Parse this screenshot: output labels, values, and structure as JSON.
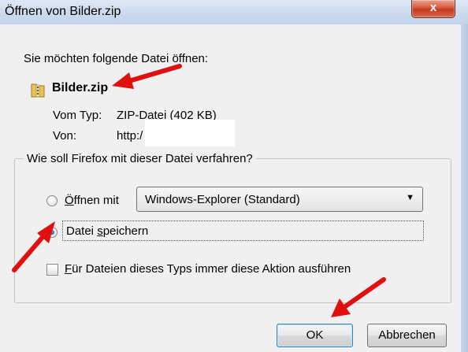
{
  "window": {
    "title": "Öffnen von Bilder.zip",
    "close_label": "x"
  },
  "dialog": {
    "prompt": "Sie möchten folgende Datei öffnen:",
    "file_name": "Bilder.zip",
    "type_label": "Vom Typ:",
    "type_value": "ZIP-Datei (402 KB)",
    "from_label": "Von:",
    "from_value": "http:/"
  },
  "action_group": {
    "legend": "Wie soll Firefox mit dieser Datei verfahren?",
    "open_with": {
      "label_prefix": "Ö",
      "label_rest": "ffnen mit",
      "selected": false
    },
    "open_with_select": {
      "value": "Windows-Explorer (Standard)"
    },
    "save": {
      "label_prefix": "Datei ",
      "label_accel": "s",
      "label_rest": "peichern",
      "selected": true
    },
    "always": {
      "label_accel": "F",
      "label_rest": "ür Dateien dieses Typs immer diese Aktion ausführen",
      "checked": false
    }
  },
  "buttons": {
    "ok": "OK",
    "cancel": "Abbrechen"
  },
  "colors": {
    "annotation_arrow": "#e01010",
    "dialog_bg": "#f0f0f0",
    "close_button": "#c9452b"
  }
}
